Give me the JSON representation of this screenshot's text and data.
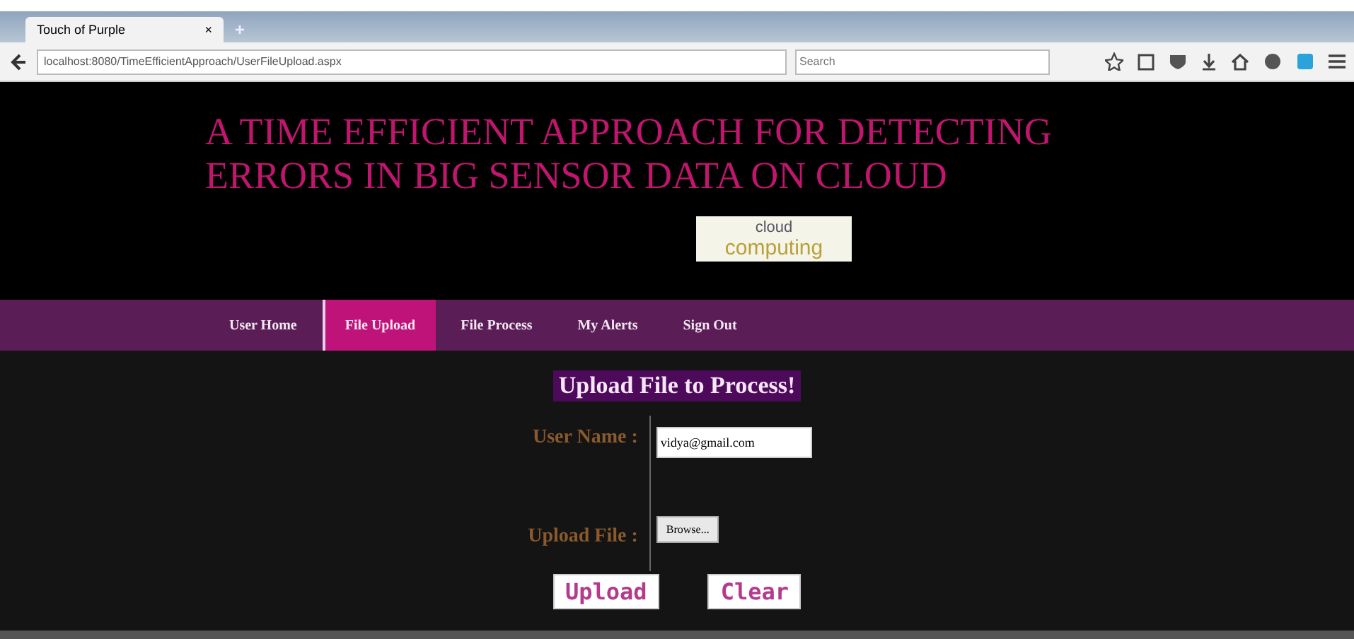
{
  "browser": {
    "tab_title": "Touch of Purple",
    "new_tab": "+",
    "close": "×",
    "url": "localhost:8080/TimeEfficientApproach/UserFileUpload.aspx",
    "search_placeholder": "Search"
  },
  "header": {
    "title": "A TIME EFFICIENT APPROACH FOR DETECTING ERRORS IN BIG SENSOR DATA ON CLOUD",
    "logo_top": "cloud",
    "logo_bottom": "computing"
  },
  "nav": [
    {
      "label": "User Home",
      "selected": false
    },
    {
      "label": "File Upload",
      "selected": true
    },
    {
      "label": "File Process",
      "selected": false
    },
    {
      "label": "My Alerts",
      "selected": false
    },
    {
      "label": "Sign Out",
      "selected": false
    }
  ],
  "form": {
    "heading": "Upload File to Process!",
    "username_label": "User Name :",
    "username_value": "vidya@gmail.com",
    "file_label": "Upload File :",
    "browse": "Browse...",
    "buttons": [
      "Upload",
      "Clear"
    ]
  }
}
